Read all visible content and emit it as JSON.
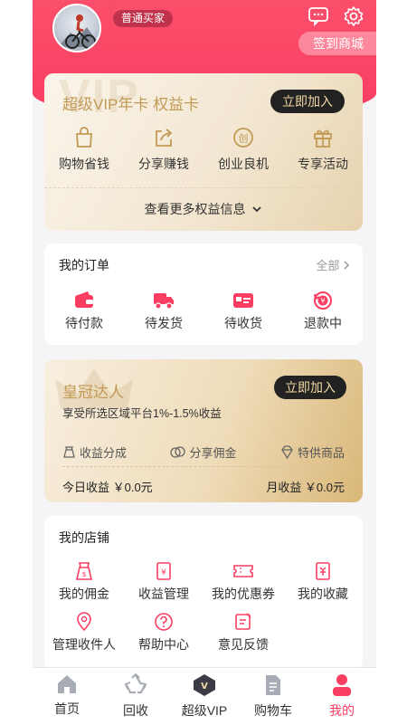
{
  "header": {
    "user_level": "普通买家",
    "sign_button": "签到商城"
  },
  "vip_card": {
    "watermark": "VIP",
    "title": "超级VIP年卡 权益卡",
    "join_button": "立即加入",
    "benefits": [
      {
        "label": "购物省钱",
        "icon": "shopping-bag-icon"
      },
      {
        "label": "分享赚钱",
        "icon": "share-icon"
      },
      {
        "label": "创业良机",
        "icon": "startup-icon"
      },
      {
        "label": "专享活动",
        "icon": "gift-icon"
      }
    ],
    "more": "查看更多权益信息"
  },
  "orders": {
    "title": "我的订单",
    "all": "全部",
    "items": [
      {
        "label": "待付款",
        "icon": "wallet-icon"
      },
      {
        "label": "待发货",
        "icon": "truck-icon"
      },
      {
        "label": "待收货",
        "icon": "receive-icon"
      },
      {
        "label": "退款中",
        "icon": "refund-icon"
      }
    ]
  },
  "crown": {
    "title": "皇冠达人",
    "subtitle": "享受所选区域平台1%-1.5%收益",
    "join_button": "立即加入",
    "perks": [
      "收益分成",
      "分享佣金",
      "特供商品"
    ],
    "today": "今日收益 ￥0.0元",
    "month": "月收益 ￥0.0元"
  },
  "shop": {
    "title": "我的店铺",
    "items": [
      {
        "label": "我的佣金",
        "icon": "money-bag-icon"
      },
      {
        "label": "收益管理",
        "icon": "income-icon"
      },
      {
        "label": "我的优惠券",
        "icon": "coupon-icon"
      },
      {
        "label": "我的收藏",
        "icon": "favorite-icon"
      },
      {
        "label": "管理收件人",
        "icon": "location-icon"
      },
      {
        "label": "帮助中心",
        "icon": "help-icon"
      },
      {
        "label": "意见反馈",
        "icon": "feedback-icon"
      }
    ]
  },
  "tabbar": [
    {
      "label": "首页",
      "icon": "home-icon"
    },
    {
      "label": "回收",
      "icon": "recycle-icon"
    },
    {
      "label": "超级VIP",
      "icon": "vip-badge-icon"
    },
    {
      "label": "购物车",
      "icon": "cart-icon"
    },
    {
      "label": "我的",
      "icon": "profile-icon"
    }
  ],
  "colors": {
    "brand": "#fa3d61",
    "gold": "#c29a55",
    "dark": "#222222"
  }
}
